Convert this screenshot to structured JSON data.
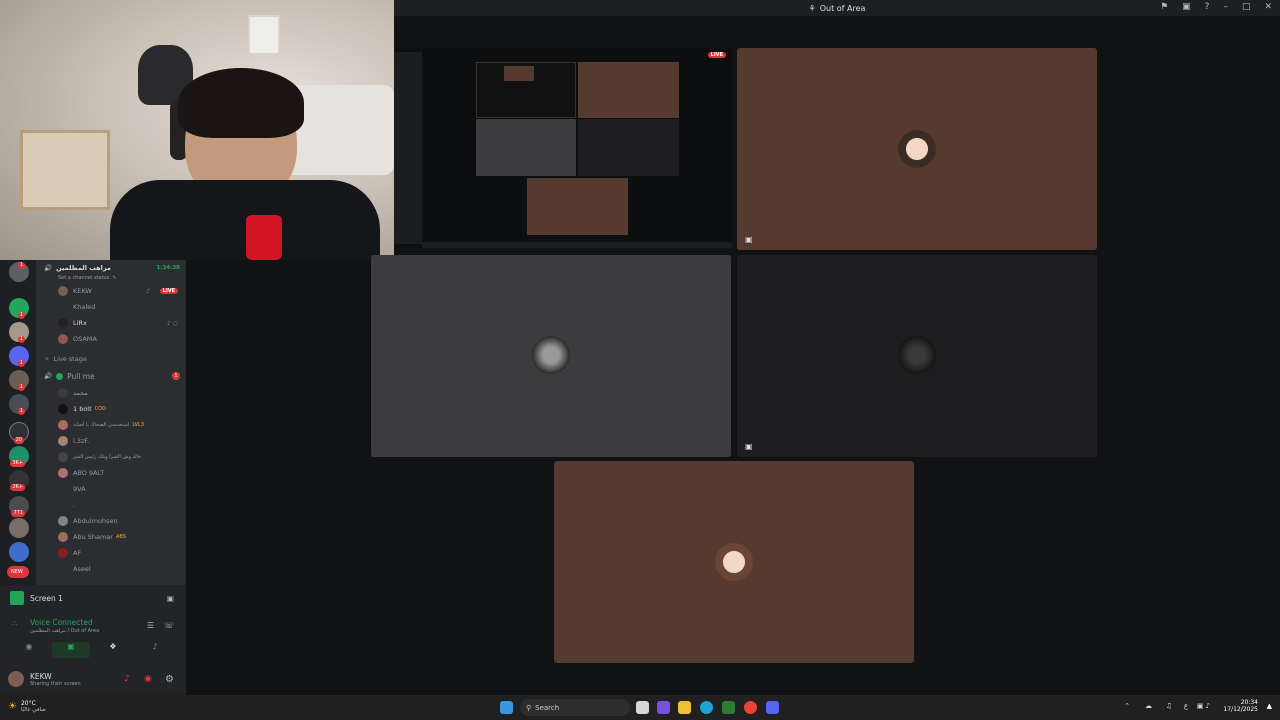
{
  "window": {
    "title": "Out of Area"
  },
  "server_badges": [
    "1",
    "1",
    "1",
    "1",
    "1",
    "1",
    "1",
    "1",
    "20",
    "3K+",
    "2K+",
    "771",
    "NEW"
  ],
  "channel": {
    "name": "مراهب المظلمين",
    "elapsed": "1:34:38",
    "status_hint": "Set a channel status",
    "members": [
      {
        "name": "KEKW",
        "live": true,
        "live_label": "LIVE"
      },
      {
        "name": "Khaled"
      },
      {
        "name": "LiRx"
      },
      {
        "name": "OSAMA"
      }
    ]
  },
  "stage": {
    "label": "Live stage"
  },
  "pull_channel": {
    "name": "Pull me",
    "badge": "1",
    "members": [
      {
        "name": "محمد"
      },
      {
        "name": "1 bolt",
        "tag": "COD"
      },
      {
        "name": "استخدمني الضحاك يا أصابة",
        "tag": "LVL3"
      },
      {
        "name": "l.3zF."
      },
      {
        "name": "خالد وش الشرا ويلك رئيس الشر"
      },
      {
        "name": "ABO 9ALT"
      },
      {
        "name": "9VA"
      },
      {
        "name": "."
      },
      {
        "name": "Abdulmohsen"
      },
      {
        "name": "Abu Shamar",
        "tag": "ABS"
      },
      {
        "name": "AF"
      },
      {
        "name": "Aseel"
      }
    ]
  },
  "screen_share": {
    "label": "Screen 1"
  },
  "voice": {
    "status": "Voice Connected",
    "location": "مراهب المظلمين / Out of Area"
  },
  "user": {
    "name": "KEKW",
    "status": "Sharing their screen"
  },
  "stream": {
    "live_label": "LIVE"
  },
  "taskbar": {
    "weather_temp": "20°C",
    "weather_desc": "صافي غالبًا",
    "search_placeholder": "Search",
    "time": "20:34",
    "date": "17/12/2025",
    "lang": "ع"
  },
  "colors": {
    "brown_tile": "#573a2f",
    "accent_green": "#23a55a",
    "live_red": "#da373c"
  }
}
